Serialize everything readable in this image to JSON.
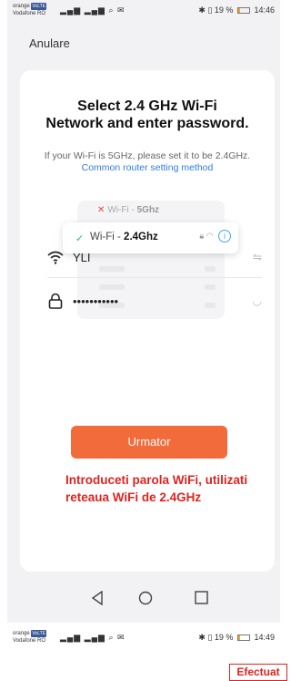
{
  "status_top": {
    "carrier_top": "orange",
    "volte_badge": "VoLTE",
    "carrier_bottom": "Vodafone RO",
    "signals": "▂▄▆ ▂▄▆ ⌕ ✉",
    "battery_percent": "19 %",
    "time": "14:46",
    "battery_level": 0.19,
    "battery_color": "#f5a623"
  },
  "header": {
    "cancel_label": "Anulare"
  },
  "card": {
    "title_line1": "Select 2.4 GHz Wi-Fi",
    "title_line2": "Network and enter password.",
    "subtitle_prefix": "If your Wi-Fi is 5GHz, please set it to be 2.4GHz.",
    "subtitle_link": "Common router setting method",
    "illustration": {
      "row_5g_prefix": "Wi-Fi - ",
      "row_5g_band": "5Ghz",
      "row_24_prefix": "Wi-Fi - ",
      "row_24_band": "2.4Ghz"
    },
    "wifi_field": {
      "value": "YLI",
      "icon": "wifi-icon",
      "aux_icon": "switch-network-icon"
    },
    "password_field": {
      "value": "•••••••••••",
      "icon": "lock-icon",
      "aux_icon": "eye-hidden-icon"
    },
    "next_label": "Urmator",
    "accent": "#f26b3a",
    "link_color": "#2f7de1"
  },
  "annotation": {
    "line1": "Introduceti parola WiFi, utilizati",
    "line2": "reteaua WiFi de 2.4GHz",
    "color": "#e0231f"
  },
  "navbar": {
    "back": "back-icon",
    "home": "home-icon",
    "recent": "recent-apps-icon"
  },
  "status_bottom": {
    "carrier_top": "orange",
    "volte_badge": "VoLTE",
    "carrier_bottom": "Vodafone RO",
    "signals": "▂▄▆ ▂▄▆ ⌕ ✉",
    "battery_percent": "19 %",
    "time": "14:49"
  },
  "done_label": "Efectuat"
}
